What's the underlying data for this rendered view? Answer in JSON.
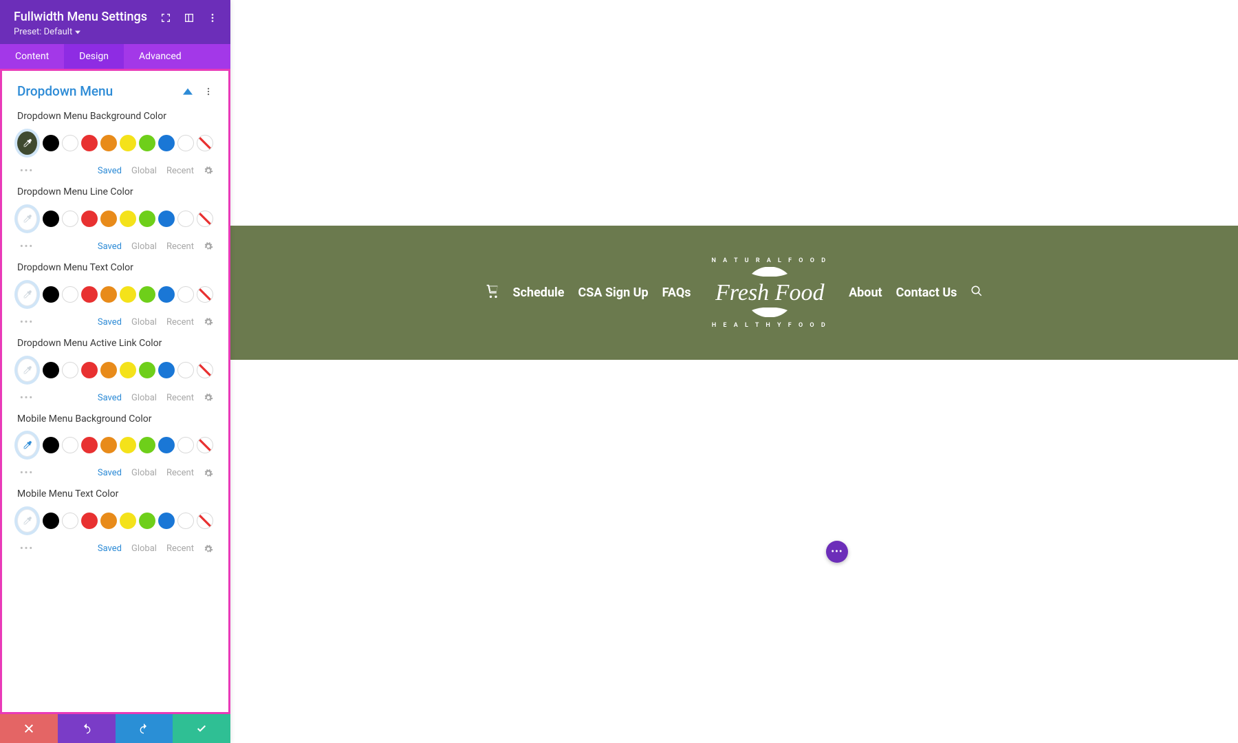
{
  "panel": {
    "title": "Fullwidth Menu Settings",
    "preset_label": "Preset: Default",
    "tabs": {
      "content": "Content",
      "design": "Design",
      "advanced": "Advanced"
    },
    "section_title": "Dropdown Menu",
    "palette_tabs": {
      "saved": "Saved",
      "global": "Global",
      "recent": "Recent"
    },
    "fields": [
      {
        "label": "Dropdown Menu Background Color",
        "picker_bg": "#3f4a30",
        "picker_icon": "#ffffff"
      },
      {
        "label": "Dropdown Menu Line Color",
        "picker_bg": "#ffffff",
        "picker_icon": "#cfd7de"
      },
      {
        "label": "Dropdown Menu Text Color",
        "picker_bg": "#ffffff",
        "picker_icon": "#cfd7de"
      },
      {
        "label": "Dropdown Menu Active Link Color",
        "picker_bg": "#ffffff",
        "picker_icon": "#cfd7de"
      },
      {
        "label": "Mobile Menu Background Color",
        "picker_bg": "#ffffff",
        "picker_icon": "#2d8bd6"
      },
      {
        "label": "Mobile Menu Text Color",
        "picker_bg": "#ffffff",
        "picker_icon": "#cfd7de"
      }
    ],
    "swatches": [
      "#000000",
      "outline",
      "#e83131",
      "#e88b1a",
      "#f4e21a",
      "#6ecf1a",
      "#1a77d6",
      "outline",
      "nocolor"
    ]
  },
  "menu": {
    "items_left": [
      "Schedule",
      "CSA Sign Up",
      "FAQs"
    ],
    "items_right": [
      "About",
      "Contact Us"
    ],
    "logo_top": "N A T U R A L   F O O D",
    "logo_mid": "Fresh Food",
    "logo_bot": "H E A L T H Y   F O O D"
  }
}
